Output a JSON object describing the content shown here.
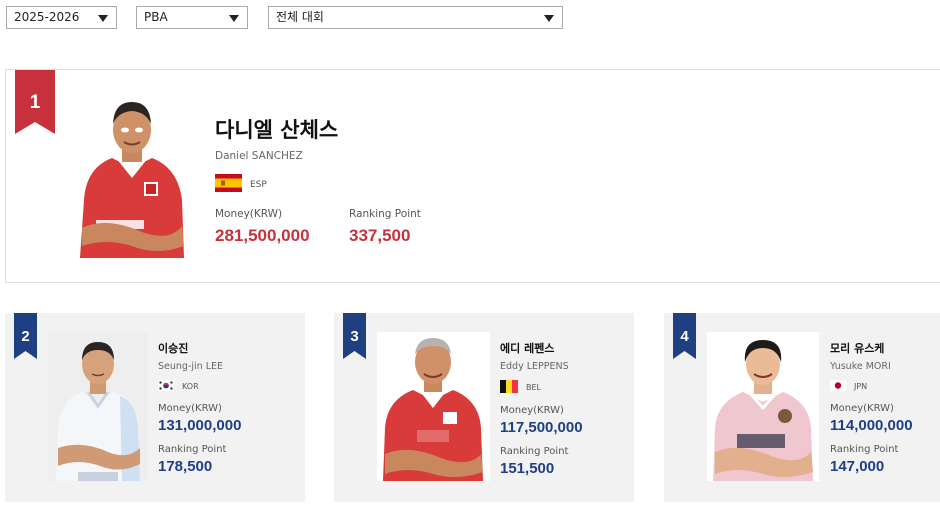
{
  "filters": {
    "season": "2025-2026",
    "league": "PBA",
    "tournament": "전체 대회"
  },
  "colors": {
    "first_rank_red": "#c8313c",
    "rank_navy": "#1e3f82"
  },
  "players": [
    {
      "rank": "1",
      "name_ko": "다니엘 산체스",
      "name_en": "Daniel SANCHEZ",
      "country": "ESP",
      "flag_icon": "spain-flag-icon",
      "money_label": "Money(KRW)",
      "money": "281,500,000",
      "points_label": "Ranking Point",
      "points": "337,500"
    },
    {
      "rank": "2",
      "name_ko": "이승진",
      "name_en": "Seung-jin LEE",
      "country": "KOR",
      "flag_icon": "korea-flag-icon",
      "money_label": "Money(KRW)",
      "money": "131,000,000",
      "points_label": "Ranking Point",
      "points": "178,500"
    },
    {
      "rank": "3",
      "name_ko": "에디 레펜스",
      "name_en": "Eddy LEPPENS",
      "country": "BEL",
      "flag_icon": "belgium-flag-icon",
      "money_label": "Money(KRW)",
      "money": "117,500,000",
      "points_label": "Ranking Point",
      "points": "151,500"
    },
    {
      "rank": "4",
      "name_ko": "모리 유스케",
      "name_en": "Yusuke MORI",
      "country": "JPN",
      "flag_icon": "japan-flag-icon",
      "money_label": "Money(KRW)",
      "money": "114,000,000",
      "points_label": "Ranking Point",
      "points": "147,000"
    }
  ]
}
